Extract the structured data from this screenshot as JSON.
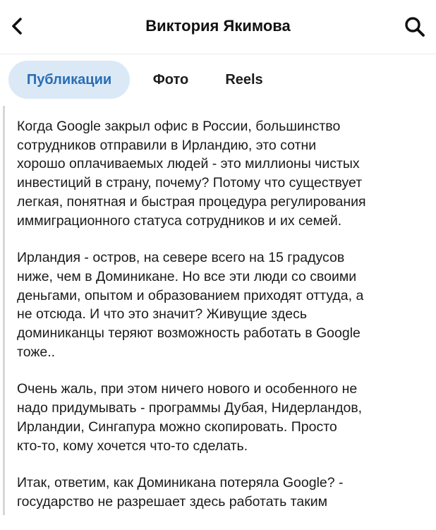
{
  "header": {
    "title": "Виктория Якимова",
    "back_icon": "chevron-left-icon",
    "search_icon": "search-icon"
  },
  "tabs": [
    {
      "label": "Публикации",
      "active": true
    },
    {
      "label": "Фото",
      "active": false
    },
    {
      "label": "Reels",
      "active": false
    }
  ],
  "colors": {
    "active_tab_bg": "#dbe9f7",
    "active_tab_text": "#2a6db5"
  },
  "post": {
    "paragraphs": [
      "Когда Google закрыл офис в России, большинство\nсотрудников отправили в Ирландию, это сотни\nхорошо оплачиваемых людей - это миллионы чистых\nинвестиций в страну, почему? Потому что существует\nлегкая, понятная и быстрая процедура регулирования\nиммиграционного статуса сотрудников и их семей.",
      "Ирландия - остров, на севере всего на 15 градусов\nниже, чем в Доминикане. Но все эти люди со своими\nденьгами, опытом и образованием приходят оттуда, а\nне отсюда. И что это значит? Живущие здесь\nдоминиканцы теряют возможность работать в Google\nтоже..",
      "Очень жаль, при этом ничего нового и особенного не\nнадо придумывать - программы Дубая, Нидерландов,\nИрландии, Сингапура можно скопировать. Просто\nкто-то, кому хочется что-то сделать.",
      "Итак, ответим, как Доминикана потеряла Google? -\nгосударство не разрешает здесь работать таким"
    ]
  }
}
